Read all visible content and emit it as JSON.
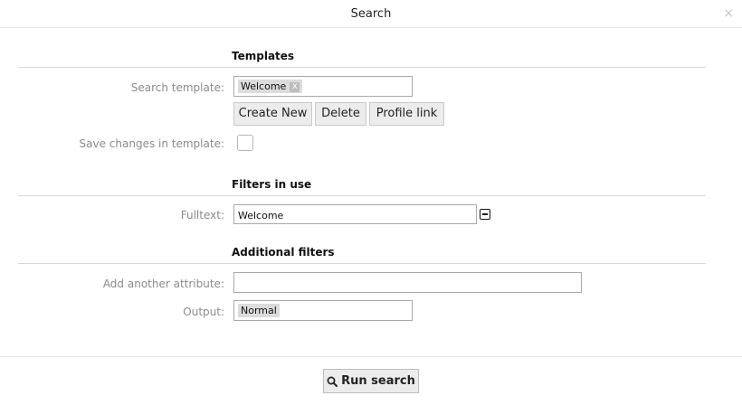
{
  "dialog": {
    "title": "Search",
    "close_glyph": "×"
  },
  "templates": {
    "heading": "Templates",
    "search_template_label": "Search template:",
    "search_template_value": "Welcome",
    "remove_glyph": "x",
    "create_new_label": "Create New",
    "delete_label": "Delete",
    "profile_link_label": "Profile link",
    "save_changes_label": "Save changes in template:",
    "save_changes_checked": false
  },
  "filters_in_use": {
    "heading": "Filters in use",
    "fulltext_label": "Fulltext:",
    "fulltext_value": "Welcome"
  },
  "additional_filters": {
    "heading": "Additional filters",
    "add_attribute_label": "Add another attribute:",
    "add_attribute_value": "",
    "output_label": "Output:",
    "output_value": "Normal"
  },
  "footer": {
    "run_search_label": "Run search",
    "run_search_icon": "search-icon"
  }
}
